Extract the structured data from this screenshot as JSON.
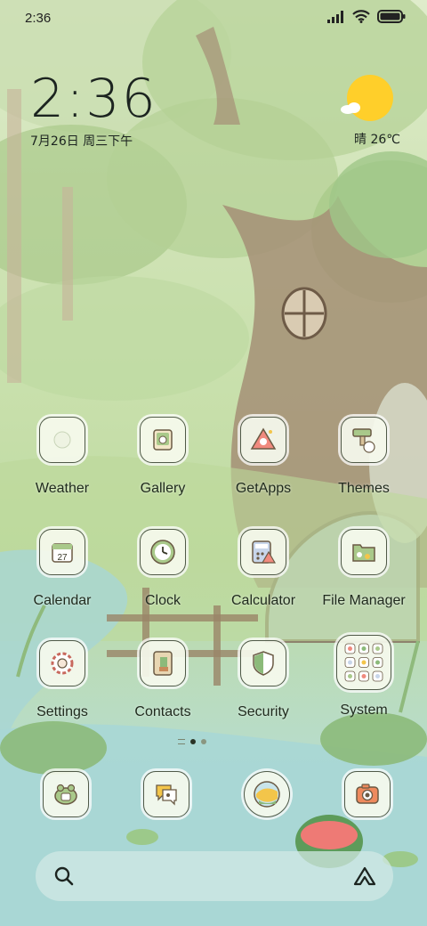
{
  "status_bar": {
    "time": "2:36",
    "icons": [
      "signal-icon",
      "wifi-icon",
      "battery-icon"
    ]
  },
  "clock_widget": {
    "time": "2:36",
    "date": "7月26日 周三下午"
  },
  "weather_widget": {
    "text": "晴 26℃",
    "icon": "sun-cloud-icon"
  },
  "apps": [
    {
      "label": "Weather",
      "icon": "weather-icon"
    },
    {
      "label": "Gallery",
      "icon": "gallery-icon"
    },
    {
      "label": "GetApps",
      "icon": "getapps-icon"
    },
    {
      "label": "Themes",
      "icon": "themes-icon"
    },
    {
      "label": "Calendar",
      "icon": "calendar-icon",
      "day": "27"
    },
    {
      "label": "Clock",
      "icon": "clock-icon"
    },
    {
      "label": "Calculator",
      "icon": "calculator-icon"
    },
    {
      "label": "File Manager",
      "icon": "file-manager-icon"
    },
    {
      "label": "Settings",
      "icon": "settings-icon"
    },
    {
      "label": "Contacts",
      "icon": "contacts-icon"
    },
    {
      "label": "Security",
      "icon": "security-icon"
    },
    {
      "label": "System",
      "icon": "system-folder-icon"
    }
  ],
  "page_indicator": {
    "pages": 2,
    "active": 0
  },
  "dock": [
    "phone-icon",
    "messages-icon",
    "browser-icon",
    "camera-icon"
  ],
  "search_bar": {
    "icon_left": "search-icon",
    "icon_right": "assistant-icon"
  },
  "colors": {
    "icon_border": "#505a48",
    "icon_fill": "#f6faee",
    "sun": "#ffcf2a",
    "text": "#1f2a1d"
  }
}
